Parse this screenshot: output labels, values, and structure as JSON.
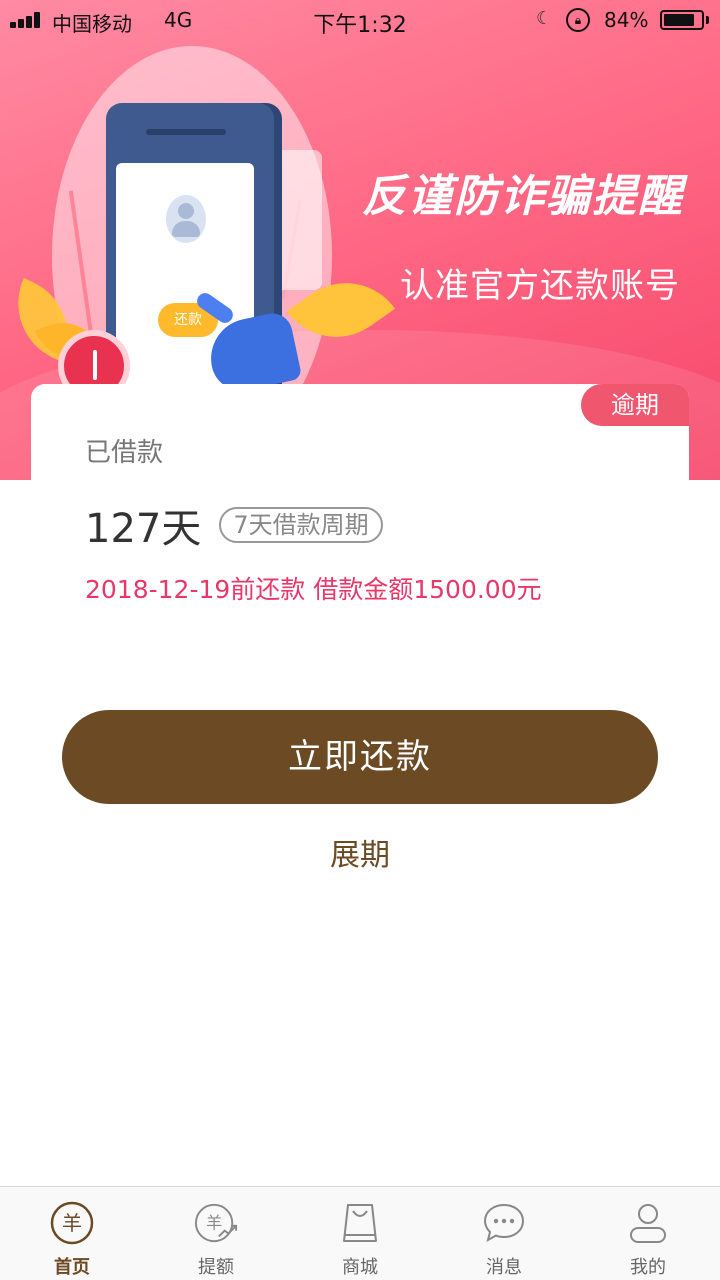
{
  "status_bar": {
    "carrier": "中国移动",
    "network": "4G",
    "time": "下午1:32",
    "battery": "84%",
    "battery_level": 0.84
  },
  "banner": {
    "title": "反谨防诈骗提醒",
    "subtitle": "认准官方还款账号",
    "phone_button": "还款"
  },
  "loan_card": {
    "badge": "逾期",
    "status_label": "已借款",
    "days": "127天",
    "cycle": "7天借款周期",
    "due_info": "2018-12-19前还款 借款金额1500.00元"
  },
  "actions": {
    "repay_label": "立即还款",
    "extend_label": "展期"
  },
  "tabbar": {
    "items": [
      {
        "label": "首页",
        "icon": "home-yang-icon",
        "active": true
      },
      {
        "label": "提额",
        "icon": "raise-limit-icon",
        "active": false
      },
      {
        "label": "商城",
        "icon": "shopping-bag-icon",
        "active": false
      },
      {
        "label": "消息",
        "icon": "chat-bubble-icon",
        "active": false
      },
      {
        "label": "我的",
        "icon": "user-icon",
        "active": false
      }
    ]
  },
  "colors": {
    "brand_brown": "#6b4a24",
    "banner_pink": "#f7466a",
    "overdue_red": "#f0566e",
    "due_text": "#e8386a"
  }
}
